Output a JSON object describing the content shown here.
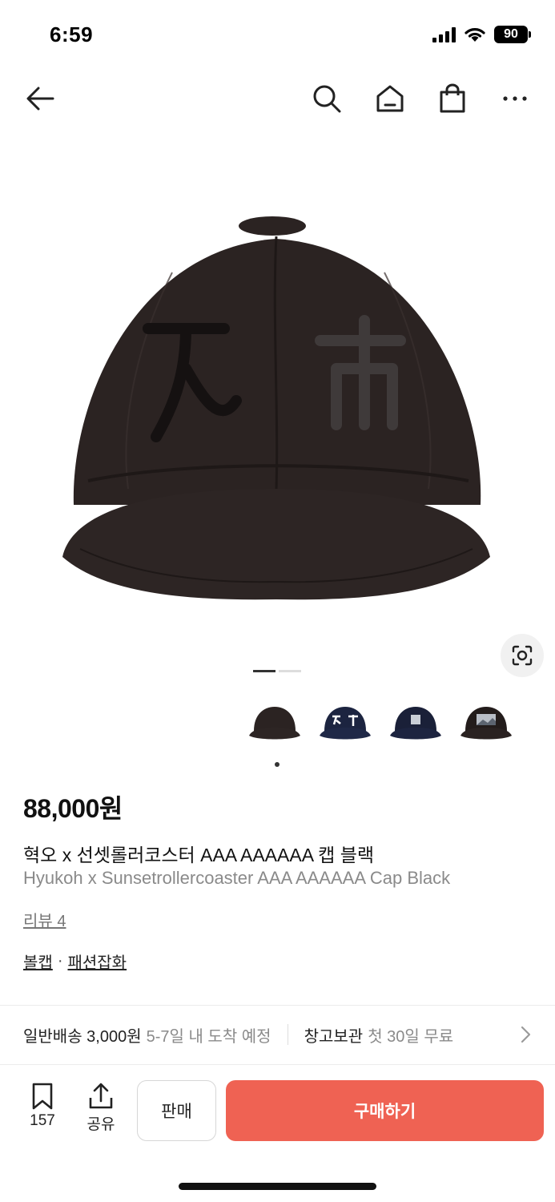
{
  "status": {
    "time": "6:59",
    "battery": "90"
  },
  "nav": {
    "back_icon": "arrow-left-icon",
    "search_icon": "search-icon",
    "home_icon": "home-icon",
    "cart_icon": "shopping-bag-icon",
    "more_icon": "more-icon"
  },
  "product": {
    "price": "88,000원",
    "title_ko": "혁오 x 선셋롤러코스터 AAA AAAAAA 캡 블랙",
    "title_en": "Hyukoh x Sunsetrollercoaster AAA AAAAAA Cap Black",
    "review": "리뷰 4",
    "categories": [
      "볼캡",
      "패션잡화"
    ],
    "category_separator": "·",
    "image_count": 2,
    "current_image": 1
  },
  "thumbnails": [
    {
      "name": "black-cap"
    },
    {
      "name": "navy-cap"
    },
    {
      "name": "navy-photo-cap"
    },
    {
      "name": "black-photo-cap"
    }
  ],
  "shipping": {
    "method": "일반배송 3,000원",
    "eta": "5-7일 내 도착 예정",
    "storage": "창고보관",
    "storage_note": "첫 30일 무료"
  },
  "actions": {
    "bookmark_count": "157",
    "share_label": "공유",
    "sell_label": "판매",
    "buy_label": "구매하기"
  },
  "colors": {
    "accent": "#ef6253",
    "cap": "#2a2221"
  }
}
